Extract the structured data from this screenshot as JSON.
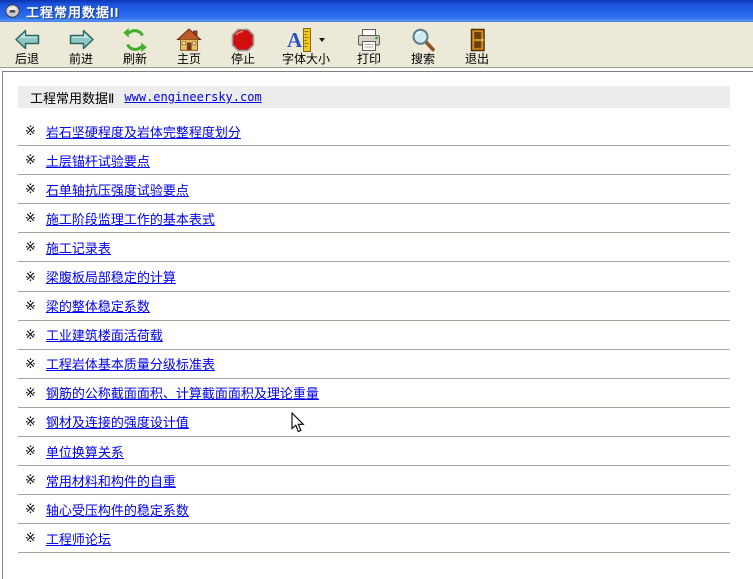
{
  "window": {
    "title": "工程常用数据II",
    "icon": "app-disc-icon"
  },
  "toolbar": {
    "buttons": [
      {
        "label": "后退",
        "icon": "back-icon"
      },
      {
        "label": "前进",
        "icon": "forward-icon"
      },
      {
        "label": "刷新",
        "icon": "refresh-icon"
      },
      {
        "label": "主页",
        "icon": "home-icon"
      },
      {
        "label": "停止",
        "icon": "stop-icon"
      },
      {
        "label": "字体大小",
        "icon": "font-size-icon",
        "has_dropdown": true
      },
      {
        "label": "打印",
        "icon": "print-icon"
      },
      {
        "label": "搜索",
        "icon": "search-icon"
      },
      {
        "label": "退出",
        "icon": "exit-icon"
      }
    ]
  },
  "content": {
    "header": {
      "title": "工程常用数据Ⅱ",
      "link": "www.engineersky.com"
    },
    "bullet": "※",
    "items": [
      {
        "label": "岩石坚硬程度及岩体完整程度划分"
      },
      {
        "label": "土层锚杆试验要点"
      },
      {
        "label": "石单轴抗压强度试验要点"
      },
      {
        "label": "施工阶段监理工作的基本表式"
      },
      {
        "label": "施工记录表"
      },
      {
        "label": "梁腹板局部稳定的计算"
      },
      {
        "label": "梁的整体稳定系数"
      },
      {
        "label": "工业建筑楼面活荷载"
      },
      {
        "label": "工程岩体基本质量分级标准表"
      },
      {
        "label": "钢筋的公称截面面积、计算截面面积及理论重量"
      },
      {
        "label": "钢材及连接的强度设计值"
      },
      {
        "label": "单位换算关系"
      },
      {
        "label": "常用材料和构件的自重"
      },
      {
        "label": "轴心受压构件的稳定系数"
      },
      {
        "label": "工程师论坛"
      }
    ]
  },
  "colors": {
    "titlebar_blue": "#2563E8",
    "toolbar_bg": "#ECE9D8",
    "link_blue": "#0000EE",
    "separator_grey": "#A6A69C",
    "header_band_grey": "#EDEDED"
  }
}
